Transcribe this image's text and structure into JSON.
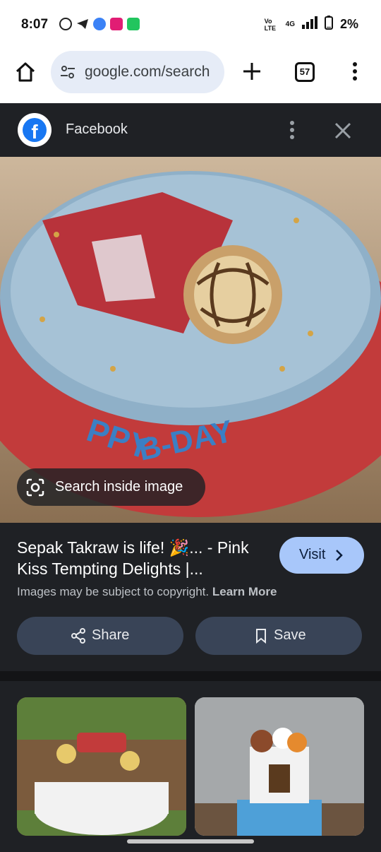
{
  "status_bar": {
    "time": "8:07",
    "network": "4G",
    "volte": "Vo LTE",
    "battery": "2%"
  },
  "browser": {
    "url": "google.com/search",
    "tab_count": "57"
  },
  "panel": {
    "source_name": "Facebook",
    "source_icon": "facebook-icon"
  },
  "image": {
    "lens_label": "Search inside image"
  },
  "result": {
    "caption": "Sepak Takraw is life! 🎉... - Pink Kiss Tempting Delights |...",
    "visit_label": "Visit",
    "copyright_text": "Images may be subject to copyright.",
    "learn_more": "Learn More",
    "share_label": "Share",
    "save_label": "Save"
  },
  "colors": {
    "accent": "#a8c7fa",
    "panel_bg": "#1f2125",
    "button_bg": "#394457"
  }
}
